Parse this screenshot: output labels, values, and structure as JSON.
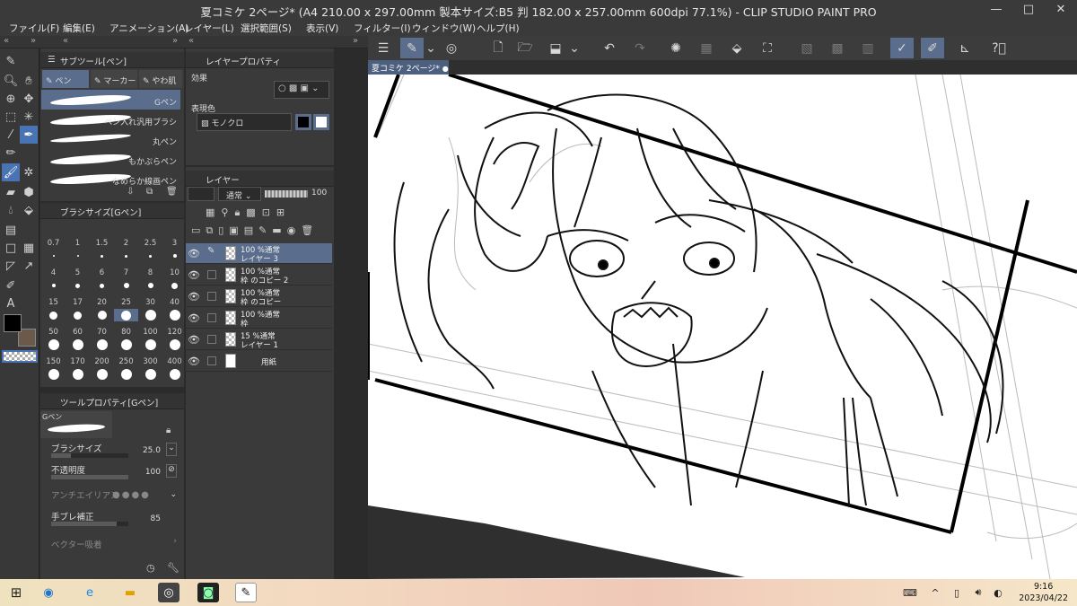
{
  "window": {
    "title": "夏コミケ 2ページ* (A4 210.00 x 297.00mm 製本サイズ:B5 判 182.00 x 257.00mm 600dpi 77.1%)  - CLIP STUDIO PAINT PRO",
    "minimize": "—",
    "maximize": "□",
    "close": "✕"
  },
  "menu": [
    "ファイル(F)",
    "編集(E)",
    "アニメーション(A)",
    "レイヤー(L)",
    "選択範囲(S)",
    "表示(V)",
    "フィルター(I)",
    "ウィンドウ(W)",
    "ヘルプ(H)"
  ],
  "subtool": {
    "title": "サブツール[ペン]",
    "tabs": [
      "ペン",
      "マーカー",
      "やわ肌"
    ],
    "brushes": [
      "Gペン",
      "ペン入れ汎用ブラシ",
      "丸ペン",
      "もかぷらペン",
      "なめらか線画ペン"
    ],
    "selected_brush": "Gペン"
  },
  "brushsize": {
    "title": "ブラシサイズ[Gペン]",
    "sizes": [
      "0.7",
      "1",
      "1.5",
      "2",
      "2.5",
      "3",
      "4",
      "5",
      "6",
      "7",
      "8",
      "10",
      "15",
      "17",
      "20",
      "25",
      "30",
      "40",
      "50",
      "60",
      "70",
      "80",
      "100",
      "120",
      "150",
      "170",
      "200",
      "250",
      "300",
      "400"
    ],
    "selected": "25"
  },
  "toolprop": {
    "title": "ツールプロパティ[Gペン]",
    "preview_label": "Gペン",
    "brush_size_label": "ブラシサイズ",
    "brush_size_value": "25.0",
    "brush_size_fill": 0.25,
    "opacity_label": "不透明度",
    "opacity_value": "100",
    "opacity_fill": 1.0,
    "antialias_label": "アンチエイリアス",
    "stabilize_label": "手ブレ補正",
    "stabilize_value": "85",
    "stabilize_fill": 0.85,
    "vector_label": "ベクター吸着"
  },
  "layerprop": {
    "title": "レイヤープロパティ",
    "effect_label": "効果",
    "expression_label": "表現色",
    "expression_value": "モノクロ"
  },
  "layers": {
    "title": "レイヤー",
    "blend_mode": "通常",
    "opacity": "100",
    "items": [
      {
        "line1": "100 %通常",
        "line2": "レイヤー 3",
        "selected": true
      },
      {
        "line1": "100 %通常",
        "line2": "枠 のコピー 2",
        "selected": false
      },
      {
        "line1": "100 %通常",
        "line2": "枠 のコピー",
        "selected": false
      },
      {
        "line1": "100 %通常",
        "line2": "枠",
        "selected": false
      },
      {
        "line1": "15 %通常",
        "line2": "レイヤー 1",
        "selected": false
      },
      {
        "line1": "",
        "line2": "用紙",
        "selected": false
      }
    ]
  },
  "document_tab": "夏コミケ 2ページ*",
  "taskbar": {
    "time": "9:16",
    "date": "2023/04/22"
  },
  "colors": {
    "accent": "#5a6d8c",
    "tool_selected": "#4a73b3",
    "main_color": "#000000",
    "sub_color": "#6b5a4a"
  }
}
